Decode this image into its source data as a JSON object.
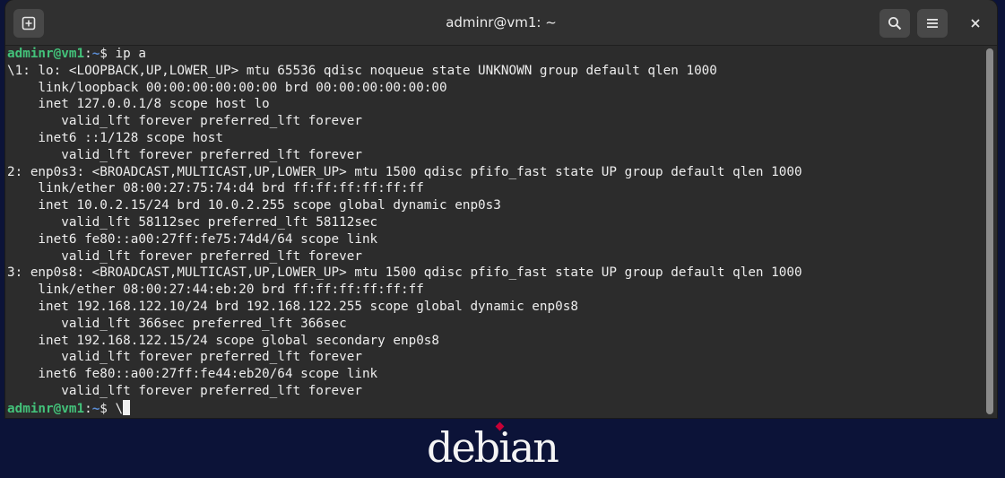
{
  "window": {
    "title": "adminr@vm1: ~",
    "new_tab_icon": "new-tab-icon",
    "search_icon": "search-icon",
    "menu_icon": "hamburger-menu-icon",
    "close_icon": "close-icon"
  },
  "prompt": {
    "user_host": "adminr@vm1",
    "colon": ":",
    "path": "~",
    "symbol": "$"
  },
  "terminal": {
    "command": " ip a",
    "output": [
      "\\1: lo: <LOOPBACK,UP,LOWER_UP> mtu 65536 qdisc noqueue state UNKNOWN group default qlen 1000",
      "    link/loopback 00:00:00:00:00:00 brd 00:00:00:00:00:00",
      "    inet 127.0.0.1/8 scope host lo",
      "       valid_lft forever preferred_lft forever",
      "    inet6 ::1/128 scope host",
      "       valid_lft forever preferred_lft forever",
      "2: enp0s3: <BROADCAST,MULTICAST,UP,LOWER_UP> mtu 1500 qdisc pfifo_fast state UP group default qlen 1000",
      "    link/ether 08:00:27:75:74:d4 brd ff:ff:ff:ff:ff:ff",
      "    inet 10.0.2.15/24 brd 10.0.2.255 scope global dynamic enp0s3",
      "       valid_lft 58112sec preferred_lft 58112sec",
      "    inet6 fe80::a00:27ff:fe75:74d4/64 scope link",
      "       valid_lft forever preferred_lft forever",
      "3: enp0s8: <BROADCAST,MULTICAST,UP,LOWER_UP> mtu 1500 qdisc pfifo_fast state UP group default qlen 1000",
      "    link/ether 08:00:27:44:eb:20 brd ff:ff:ff:ff:ff:ff",
      "    inet 192.168.122.10/24 brd 192.168.122.255 scope global dynamic enp0s8",
      "       valid_lft 366sec preferred_lft 366sec",
      "    inet 192.168.122.15/24 scope global secondary enp0s8",
      "       valid_lft forever preferred_lft forever",
      "    inet6 fe80::a00:27ff:fe44:eb20/64 scope link",
      "       valid_lft forever preferred_lft forever"
    ],
    "pending_input": " \\"
  },
  "wallpaper": {
    "logo_text": "debian"
  },
  "colors": {
    "prompt_user": "#43c27a",
    "prompt_path": "#5b8dd6",
    "terminal_bg": "#2c2c2c",
    "titlebar_bg": "#303030",
    "desktop_bg": "#0c1338",
    "debian_red": "#c70036"
  }
}
